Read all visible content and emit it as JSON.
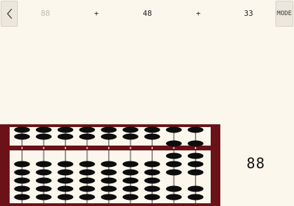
{
  "header": {
    "back_icon": "chevron-left-icon",
    "mode_label": "MODE",
    "equation": [
      {
        "text": "88",
        "kind": "number",
        "muted": true
      },
      {
        "text": "+",
        "kind": "operator",
        "muted": false
      },
      {
        "text": "48",
        "kind": "number",
        "muted": false
      },
      {
        "text": "+",
        "kind": "operator",
        "muted": false
      },
      {
        "text": "33",
        "kind": "number",
        "muted": false
      }
    ]
  },
  "result": "88",
  "abacus": {
    "rods": 9,
    "upper_beads_per_rod": 2,
    "lower_beads_per_rod": 5,
    "displayed_digits": [
      0,
      0,
      0,
      0,
      0,
      0,
      0,
      8,
      8
    ],
    "colors": {
      "frame": "#6b1218",
      "bead": "#0d0d0d",
      "rod": "#9a8f8c",
      "background": "#fbf7ed"
    }
  }
}
